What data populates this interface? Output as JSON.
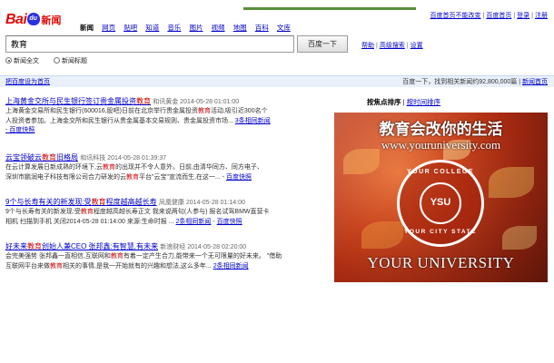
{
  "top_links": [
    "百度首页不能改变",
    "百度首页",
    "登录",
    "注册"
  ],
  "logo": {
    "bai": "Bai",
    "du": "du",
    "news": "新闻"
  },
  "nav": {
    "current": "新闻",
    "items": [
      "网页",
      "贴吧",
      "知道",
      "音乐",
      "图片",
      "视频",
      "地图",
      "百科",
      "文库"
    ]
  },
  "search": {
    "query": "教育",
    "button": "百度一下",
    "links": [
      "帮助",
      "高级搜索",
      "设置"
    ]
  },
  "scope": {
    "options": [
      "新闻全文",
      "新闻标题"
    ],
    "selected": "新闻全文"
  },
  "info_bar": {
    "set_home": "把百度设为首页",
    "count": "百度一下，找到相关新闻约92,800,000篇",
    "link": "新闻首页"
  },
  "sort": {
    "label": "按焦点排序",
    "alt": "按时间排序"
  },
  "results": [
    {
      "title_pre": "上海黄金交所与民生银行签订贵金属投资",
      "title_hl": "教育",
      "title_post": "",
      "meta": "和讯黄金 2014-05-28 01:01:00",
      "snippet1": "上海黄金交易所和民生银行(600016,股吧)日前在北京举行贵金属投资",
      "snippet1_hl": "教育",
      "snippet1_post": "活动,吸引近300名个",
      "snippet2": "人投资者参加。上海金交所和民生银行从贵金属基本交易规则、贵金属投资市场...",
      "more": "3条相同新闻",
      "extra": "- 百度快照"
    },
    {
      "title_pre": "云宝领破云",
      "title_hl": "教育",
      "title_post": "旧格局",
      "meta": "和讯科技 2014-05-28 01:39:37",
      "snippet1": "在云计算发展日新成熟的环境下,云",
      "snippet1_hl": "教育",
      "snippet1_post": "的出现并不令人意外。日前,由清华同方、同方电子、",
      "snippet2": "深圳市鹏润电子科技有限公司合力研发的云",
      "snippet2_hl": "教育",
      "snippet2_post": "平台\"云宝\"宣流而生,在这一...",
      "more": "",
      "extra": "百度快照"
    },
    {
      "title_pre": "9个与长寿有关的新发现:受",
      "title_hl": "教育",
      "title_post": "程度越高越长寿",
      "meta": "凤凰健康 2014-05-28 01:14:00",
      "snippet1": "9个与长寿有关的新发现:受",
      "snippet1_hl": "教育",
      "snippet1_post": "程度越高越长寿正文 我来说两句(人参与) 报名试驾BMW直营卡",
      "snippet2": "相机 扫描到手机 关闭2014-05-28 01:14:00 来源:生命时报 ...",
      "more": "2条相同新闻",
      "extra": "百度快照"
    },
    {
      "title_pre": "好未来",
      "title_hl": "教育",
      "title_post": "创始人兼CEO 张邦鑫:有智慧,有未来",
      "meta": "新浪财经 2014-05-28 02:20:00",
      "snippet1": "会完美强势 张邦鑫一直相信,互联网和",
      "snippet1_hl": "教育",
      "snippet1_post": "有着一定产生合力,能带来一个无可限量的好未来。 \"借助",
      "snippet2": "互联网平台来做",
      "snippet2_hl": "教育",
      "snippet2_post": "相关的事情,是我一开始就有的兴趣和想法,这么多年...",
      "more": "2条相同新闻",
      "extra": ""
    }
  ],
  "ad": {
    "headline": "教育会改你的生活",
    "url": "www.youruniversity.com",
    "seal_top": "YOUR COLLEGE",
    "seal_mid": "YSU",
    "seal_bot": "YOUR CITY STATE",
    "bottom": "YOUR UNIVERSITY"
  },
  "colors": {
    "brand_red": "#e10602",
    "brand_blue": "#2932e1",
    "link": "#0000cc",
    "highlight": "#cc0000"
  }
}
